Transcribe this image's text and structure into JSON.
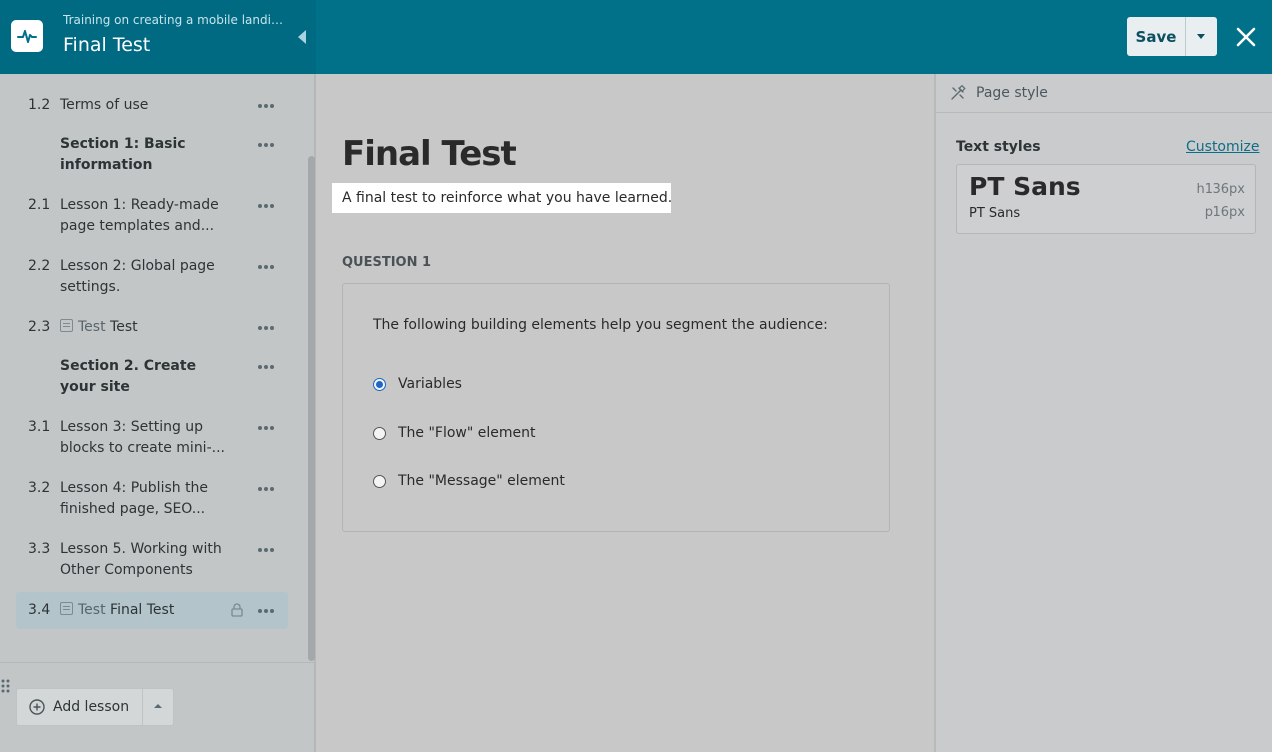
{
  "header": {
    "breadcrumb": "Training on creating a mobile landing p...",
    "title": "Final Test",
    "save_label": "Save"
  },
  "sidebar": {
    "items": [
      {
        "num": "1.2",
        "title": "Terms of use",
        "type": "lesson"
      },
      {
        "num": "",
        "title": "Section 1: Basic information",
        "type": "section"
      },
      {
        "num": "2.1",
        "title": "Lesson 1: Ready-made page templates and...",
        "type": "lesson"
      },
      {
        "num": "2.2",
        "title": "Lesson 2: Global page settings.",
        "type": "lesson"
      },
      {
        "num": "2.3",
        "kind": "Test",
        "title": "Test",
        "type": "test"
      },
      {
        "num": "",
        "title": "Section 2. Create your site",
        "type": "section"
      },
      {
        "num": "3.1",
        "title": "Lesson 3: Setting up blocks to create mini-...",
        "type": "lesson"
      },
      {
        "num": "3.2",
        "title": "Lesson 4: Publish the finished page, SEO...",
        "type": "lesson"
      },
      {
        "num": "3.3",
        "title": "Lesson 5. Working with Other Components",
        "type": "lesson"
      },
      {
        "num": "3.4",
        "kind": "Test",
        "title": "Final Test",
        "type": "test",
        "active": true,
        "locked": true
      }
    ],
    "add_lesson_label": "Add lesson"
  },
  "main": {
    "heading": "Final Test",
    "description": "A final test to reinforce what you have learned.",
    "question_label": "QUESTION 1",
    "question_text": "The following building elements help you segment the audience:",
    "options": [
      "Variables",
      "The \"Flow\" element",
      "The \"Message\" element"
    ],
    "selected_option": "Variables"
  },
  "panel": {
    "tab_label": "Page style",
    "text_styles_label": "Text styles",
    "customize_label": "Customize",
    "heading_font": "PT Sans",
    "heading_tag": "h1",
    "heading_size": "36px",
    "body_font": "PT Sans",
    "body_tag": "p",
    "body_size": "16px"
  },
  "colors": {
    "header_bg": "#01718a",
    "accent_link": "#0f6d87",
    "radio_selected": "#1b66c9"
  }
}
